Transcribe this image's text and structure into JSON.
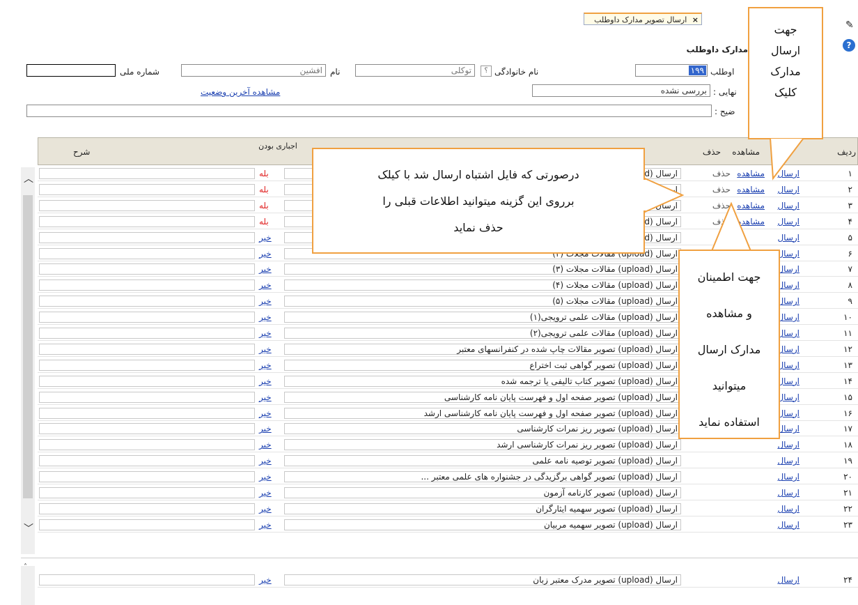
{
  "tab": {
    "label": "ارسال تصویر مدارک داوطلب",
    "close": "×"
  },
  "form": {
    "section_title": "مدارک داوطلب",
    "national_id_label": "شماره ملی",
    "first_name_label": "نام",
    "first_name_value": "افشین",
    "last_name_label": "نام خانوادگی",
    "last_name_value": "توکلی",
    "applicant_label": "اوطلب",
    "applicant_value": "۱۹۹",
    "final_status_label": "نهایی :",
    "final_status_value": "بررسی نشده",
    "last_status_link": "مشاهده آخرین وضعیت",
    "explanation_label": "ضیح :"
  },
  "table": {
    "headers": {
      "row": "ردیف",
      "view": "مشاهده",
      "delete": "حذف",
      "required": "اجباری بودن",
      "description": "شرح"
    },
    "send_label": "ارسال",
    "view_label": "مشاهده",
    "delete_label": "حذف",
    "rows": [
      {
        "num": "۱",
        "title": "ارسال (upload) مقالات مجلات (۱)",
        "req": "بله",
        "view": true
      },
      {
        "num": "۲",
        "title": "ارسال (upload) مقالات مجلات",
        "req": "بله",
        "view": true
      },
      {
        "num": "۳",
        "title": "ارسال (upload) مقالات مجلات",
        "req": "بله",
        "view": true
      },
      {
        "num": "۴",
        "title": "ارسال (upload) مقالات مجلات",
        "req": "بله",
        "view": true
      },
      {
        "num": "۵",
        "title": "ارسال (upload) مقالات مجلات (۱)",
        "req": "خیر",
        "view": false
      },
      {
        "num": "۶",
        "title": "ارسال (upload) مقالات مجلات (۲)",
        "req": "خیر",
        "view": false
      },
      {
        "num": "۷",
        "title": "ارسال (upload) مقالات مجلات (۳)",
        "req": "خیر",
        "view": false
      },
      {
        "num": "۸",
        "title": "ارسال (upload) مقالات مجلات (۴)",
        "req": "خیر",
        "view": false
      },
      {
        "num": "۹",
        "title": "ارسال (upload) مقالات مجلات (۵)",
        "req": "خیر",
        "view": false
      },
      {
        "num": "۱۰",
        "title": "ارسال (upload) مقالات علمی ترویجی(۱)",
        "req": "خیر",
        "view": false
      },
      {
        "num": "۱۱",
        "title": "ارسال (upload) مقالات علمی ترویجی(۲)",
        "req": "خیر",
        "view": false
      },
      {
        "num": "۱۲",
        "title": "ارسال (upload) تصویر مقالات چاپ شده در کنفرانسهای معتبر",
        "req": "خیر",
        "view": false
      },
      {
        "num": "۱۳",
        "title": "ارسال (upload) تصویر گواهی ثبت اختراع",
        "req": "خیر",
        "view": false
      },
      {
        "num": "۱۴",
        "title": "ارسال (upload) تصویر کتاب تالیفی یا ترجمه شده",
        "req": "خیر",
        "view": false
      },
      {
        "num": "۱۵",
        "title": "ارسال (upload) تصویر صفحه اول و فهرست پایان نامه کارشناسی",
        "req": "خیر",
        "view": false
      },
      {
        "num": "۱۶",
        "title": "ارسال (upload) تصویر صفحه اول و فهرست پایان نامه کارشناسی ارشد",
        "req": "خیر",
        "view": false
      },
      {
        "num": "۱۷",
        "title": "ارسال (upload) تصویر ریز نمرات کارشناسی",
        "req": "خیر",
        "view": false
      },
      {
        "num": "۱۸",
        "title": "ارسال (upload) تصویر ریز نمرات کارشناسی ارشد",
        "req": "خیر",
        "view": false
      },
      {
        "num": "۱۹",
        "title": "ارسال (upload) تصویر توصیه نامه علمی",
        "req": "خیر",
        "view": false
      },
      {
        "num": "۲۰",
        "title": "ارسال (upload) تصویر گواهی برگزیدگی در جشنواره های علمی معتبر ...",
        "req": "خیر",
        "view": false
      },
      {
        "num": "۲۱",
        "title": "ارسال (upload) تصویر کارنامه آزمون",
        "req": "خیر",
        "view": false
      },
      {
        "num": "۲۲",
        "title": "ارسال (upload) تصویر سهمیه ایثارگران",
        "req": "خیر",
        "view": false
      },
      {
        "num": "۲۳",
        "title": "ارسال (upload) تصویر سهمیه مربیان",
        "req": "خیر",
        "view": false
      }
    ],
    "extra_row": {
      "num": "۲۴",
      "title": "ارسال (upload) تصویر مدرک معتبر زبان",
      "req": "خیر"
    }
  },
  "callouts": {
    "send": [
      "جهت",
      "ارسال",
      "مدارک",
      "کلیک"
    ],
    "delete": [
      "درصورتی که فایل اشتباه ارسال شد با کیلک",
      "برروی این گزینه میتوانید اطلاعات قبلی را",
      "حذف نماید"
    ],
    "view": [
      "جهت اطمینان",
      "و مشاهده",
      "مدارک ارسال",
      "میتوانید",
      "استفاده نماید"
    ]
  },
  "colors": {
    "accent": "#f0a040",
    "link": "#1a3fb0",
    "required_yes": "#e02020",
    "header_bg": "#e8e4d8"
  }
}
